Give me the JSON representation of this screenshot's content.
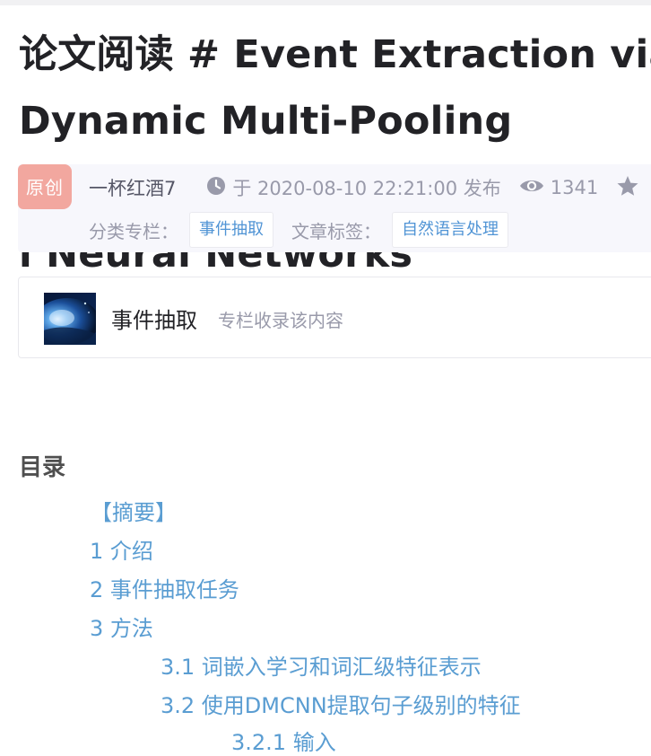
{
  "article": {
    "title": "论文阅读 # Event Extraction via Dynamic Multi-Pooling Convolutiona\nl Neural Networks"
  },
  "meta": {
    "badge": "原创",
    "author": "一杯红酒7",
    "published": "于 2020-08-10 22:21:00 发布",
    "views": "1341",
    "category_label": "分类专栏：",
    "category_tag": "事件抽取",
    "tags_label": "文章标签：",
    "article_tag": "自然语言处理"
  },
  "column": {
    "name": "事件抽取",
    "subtitle": "专栏收录该内容"
  },
  "toc": {
    "heading": "目录",
    "items": [
      {
        "label": "【摘要】"
      },
      {
        "label": "1 介绍"
      },
      {
        "label": "2 事件抽取任务"
      },
      {
        "label": "3 方法"
      },
      {
        "label": "3.1 词嵌入学习和词汇级特征表示"
      },
      {
        "label": "3.2 使用DMCNN提取句子级别的特征"
      },
      {
        "label": "3.2.1 输入"
      }
    ]
  },
  "colors": {
    "badge": "#f2a79f",
    "link": "#5a9dd2",
    "tag": "#5094d5",
    "meta_text": "#999aaa"
  },
  "icons": [
    "clock-icon",
    "eye-icon",
    "star-icon"
  ]
}
